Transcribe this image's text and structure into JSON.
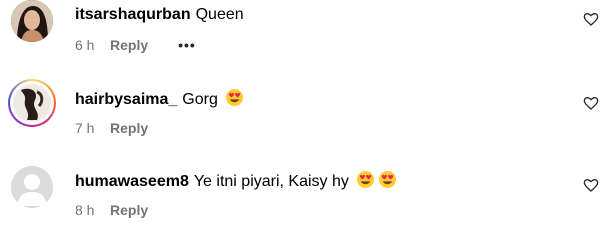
{
  "colors": {
    "text": "#000000",
    "secondary": "#737373",
    "background": "#ffffff"
  },
  "comments": [
    {
      "username": "itsarshaqurban",
      "text": "Queen",
      "time": "6 h",
      "reply_label": "Reply",
      "more_label": "•••",
      "emojis": [],
      "avatar_icon": "user-photo-avatar"
    },
    {
      "username": "hairbysaima_",
      "text": "Gorg",
      "time": "7 h",
      "reply_label": "Reply",
      "emojis": [
        "heart-eyes-emoji"
      ],
      "avatar_icon": "story-ring-avatar"
    },
    {
      "username": "humawaseem8",
      "text": "Ye itni piyari, Kaisy hy",
      "time": "8 h",
      "reply_label": "Reply",
      "emojis": [
        "heart-eyes-emoji",
        "heart-eyes-emoji"
      ],
      "avatar_icon": "default-user-avatar"
    }
  ]
}
